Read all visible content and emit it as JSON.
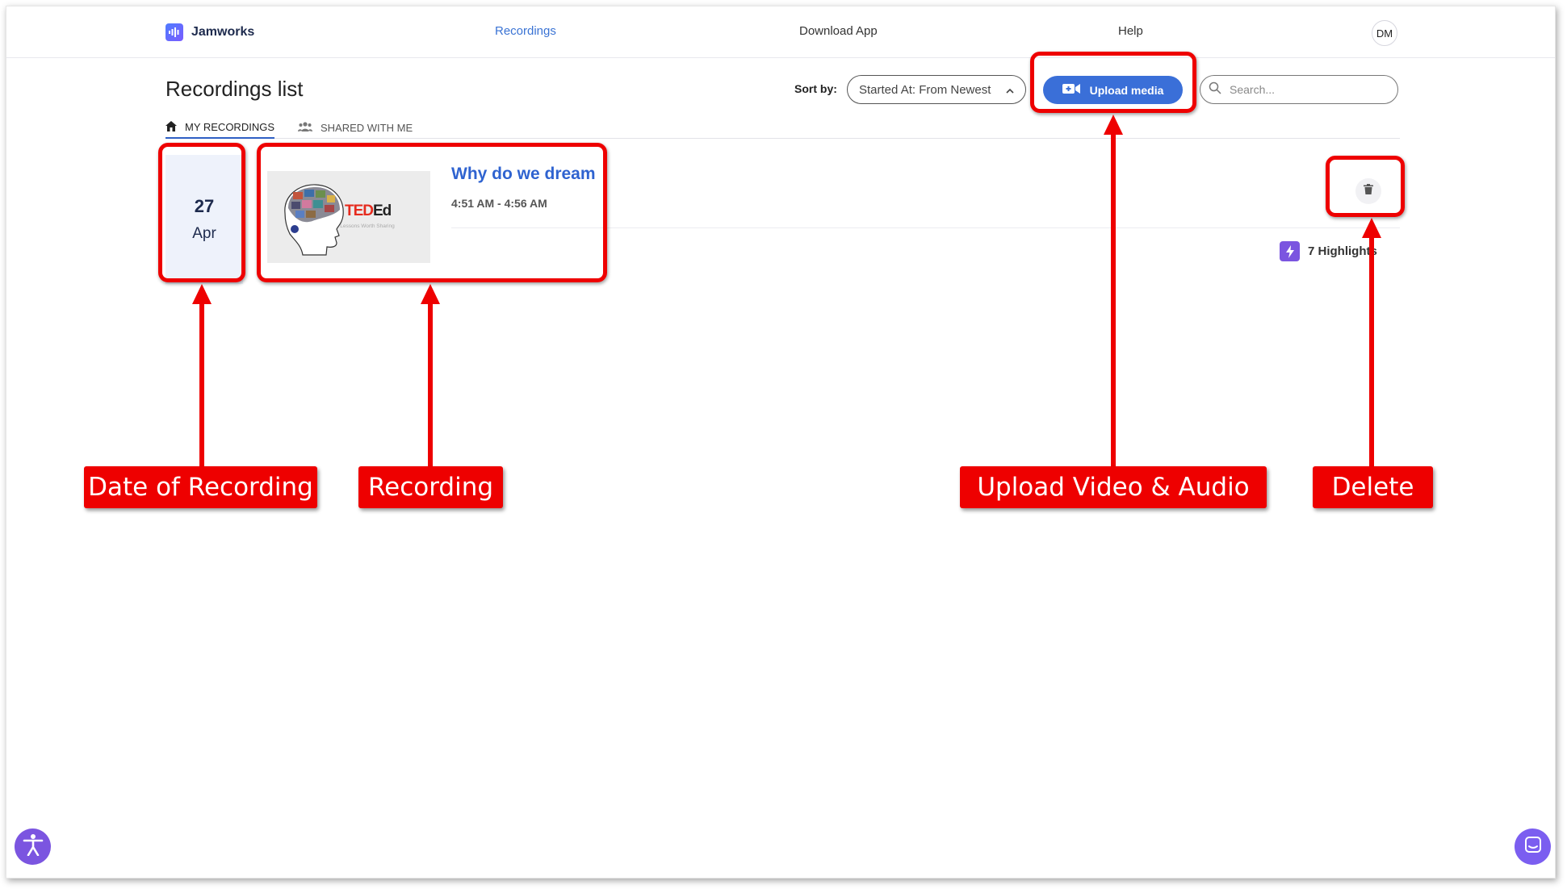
{
  "app": {
    "name": "Jamworks"
  },
  "nav": {
    "recordings": "Recordings",
    "download_app": "Download App",
    "help": "Help",
    "avatar_initials": "DM"
  },
  "page": {
    "title": "Recordings list"
  },
  "toolbar": {
    "sort_label": "Sort by:",
    "sort_value": "Started At: From Newest",
    "upload_label": "Upload media",
    "search_placeholder": "Search..."
  },
  "tabs": [
    {
      "label": "MY RECORDINGS",
      "active": true
    },
    {
      "label": "SHARED WITH ME",
      "active": false
    }
  ],
  "recordings": [
    {
      "day": "27",
      "month": "Apr",
      "title": "Why do we dream",
      "time": "4:51 AM - 4:56 AM",
      "highlights": "7 Highlights",
      "thumbnail": {
        "brand": "TEDEd",
        "brand_red": "TED",
        "brand_dark": "Ed",
        "tagline": "Lessons Worth Sharing"
      }
    }
  ],
  "annotations": {
    "date": "Date of Recording",
    "recording": "Recording",
    "upload": "Upload Video & Audio",
    "delete": "Delete"
  },
  "colors": {
    "accent": "#3a6fd8",
    "link": "#2f63d0",
    "annotation_red": "#ee0000",
    "purple": "#7b55e0",
    "date_card_bg": "#eef2fb"
  }
}
